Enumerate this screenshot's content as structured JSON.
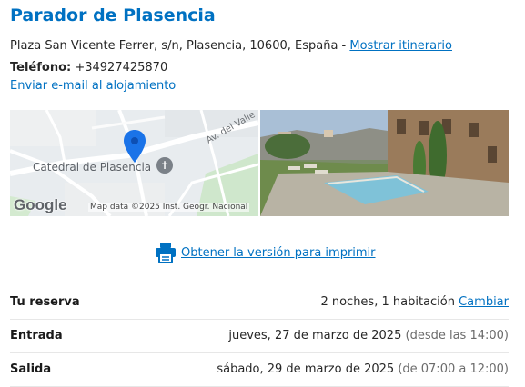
{
  "hotel": {
    "name": "Parador de Plasencia",
    "address": "Plaza San Vicente Ferrer, s/n, Plasencia, 10600, España - ",
    "itinerary_link": "Mostrar itinerario",
    "phone_label": "Teléfono:",
    "phone_value": "+34927425870",
    "email_link": "Enviar e-mail al alojamiento"
  },
  "map": {
    "landmark": "Catedral de Plasencia",
    "street": "Av. del Valle",
    "logo": "Google",
    "attribution": "Map data ©2025 Inst. Geogr. Nacional",
    "pin_color": "#1a73e8"
  },
  "print": {
    "icon": "printer-icon",
    "link": "Obtener la versión para imprimir",
    "icon_color": "#0071c2"
  },
  "booking": {
    "reservation": {
      "label": "Tu reserva",
      "value": "2 noches, 1 habitación",
      "action": "Cambiar"
    },
    "checkin": {
      "label": "Entrada",
      "date": "jueves, 27 de marzo de 2025",
      "note": "(desde las 14:00)"
    },
    "checkout": {
      "label": "Salida",
      "date": "sábado, 29 de marzo de 2025",
      "note": "(de 07:00 a 12:00)"
    }
  },
  "colors": {
    "brand": "#0071c2",
    "text": "#262626",
    "muted": "#6b6b6b"
  }
}
